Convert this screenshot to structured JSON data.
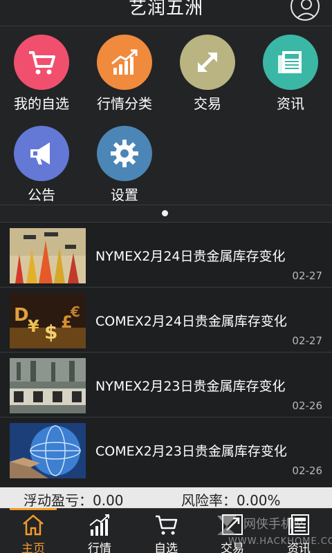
{
  "header": {
    "title": "艺润五洲"
  },
  "grid": {
    "items": [
      {
        "label": "我的自选",
        "color": "#f0506e",
        "icon": "cart-icon"
      },
      {
        "label": "行情分类",
        "color": "#f08a3c",
        "icon": "chart-up-icon"
      },
      {
        "label": "交易",
        "color": "#b9b482",
        "icon": "expand-arrows-icon"
      },
      {
        "label": "资讯",
        "color": "#3bb7a6",
        "icon": "newspaper-icon"
      },
      {
        "label": "公告",
        "color": "#6478d6",
        "icon": "megaphone-icon"
      },
      {
        "label": "设置",
        "color": "#4b86b6",
        "icon": "gear-icon"
      }
    ]
  },
  "news": [
    {
      "title": "NYMEX2月24日贵金属库存变化",
      "date": "02-27"
    },
    {
      "title": "COMEX2月24日贵金属库存变化",
      "date": "02-27"
    },
    {
      "title": "NYMEX2月23日贵金属库存变化",
      "date": "02-26"
    },
    {
      "title": "COMEX2月23日贵金属库存变化",
      "date": "02-26"
    }
  ],
  "status": {
    "pnl": "浮动盈亏：0.00",
    "risk": "风险率：0.00%"
  },
  "tabs": [
    {
      "label": "主页",
      "icon": "home-icon",
      "active": true
    },
    {
      "label": "行情",
      "icon": "chart-icon"
    },
    {
      "label": "自选",
      "icon": "cart-icon"
    },
    {
      "label": "交易",
      "icon": "trade-icon"
    },
    {
      "label": "资讯",
      "icon": "news-icon"
    }
  ],
  "watermark": {
    "line1": "网侠手机站",
    "line2": "WWW.HACKHOME.COM"
  },
  "colors": {
    "accent": "#f39a2c",
    "background": "#1f2022"
  }
}
